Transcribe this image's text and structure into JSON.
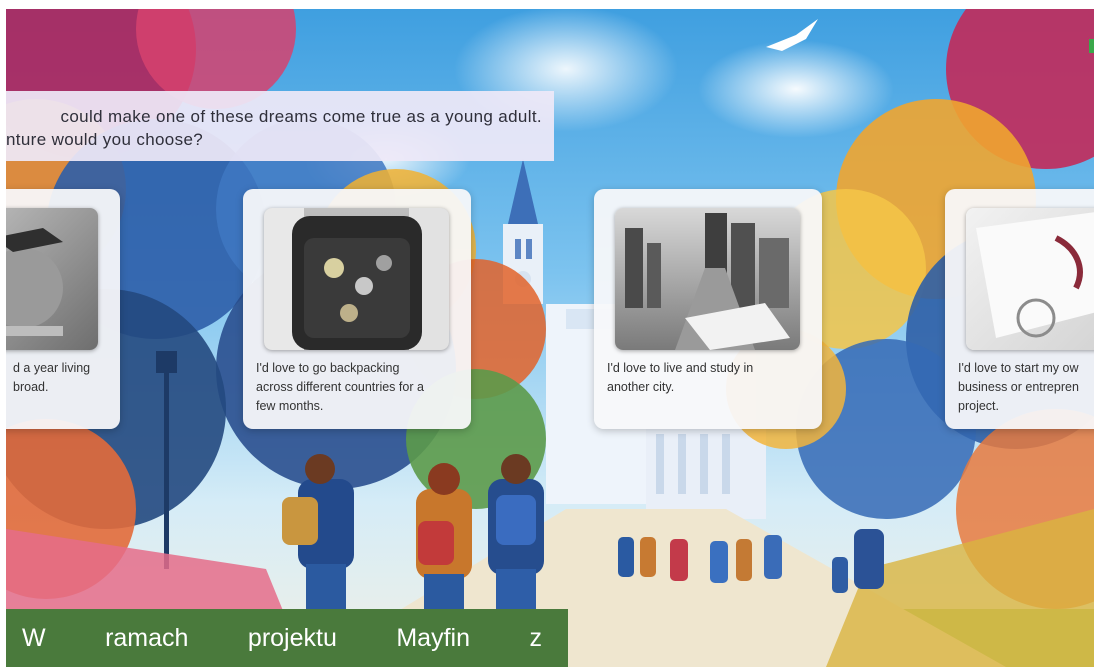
{
  "question": {
    "line1": "could make one of these dreams come true as a young adult.",
    "line2": "nture would you choose?"
  },
  "cards": [
    {
      "caption_lines": [
        "d a year living",
        "broad."
      ],
      "image_icon": "globe-graduation-cap-photo"
    },
    {
      "caption_lines": [
        "I'd love to go backpacking",
        "across different countries for a",
        "few months."
      ],
      "image_icon": "backpack-with-patches-photo"
    },
    {
      "caption_lines": [
        "I'd love to live and study in",
        "another city."
      ],
      "image_icon": "city-street-map-photo"
    },
    {
      "caption_lines": [
        "I'd love to start my ow",
        "business or entrepren",
        "project."
      ],
      "image_icon": "certificate-with-ribbon-photo"
    }
  ],
  "banner": {
    "words": [
      "W",
      "ramach",
      "projektu",
      "Mayfin",
      "z"
    ]
  },
  "colors": {
    "banner": "#4a7a3c",
    "question_bg": "#eee8f8",
    "card_bg": "#f8f8fa"
  }
}
